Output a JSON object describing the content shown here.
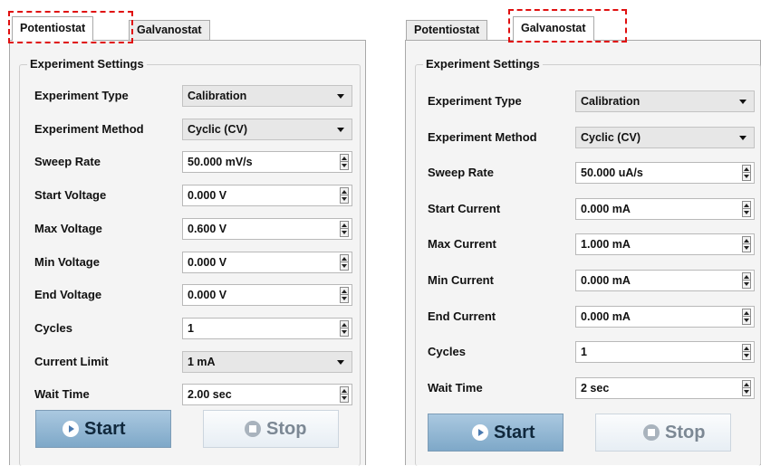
{
  "left_panel": {
    "tabs": [
      {
        "label": "Potentiostat",
        "selected": true
      },
      {
        "label": "Galvanostat",
        "selected": false
      }
    ],
    "group_title": "Experiment Settings",
    "rows": [
      {
        "label": "Experiment Type",
        "value": "Calibration",
        "control": "dropdown"
      },
      {
        "label": "Experiment Method",
        "value": "Cyclic (CV)",
        "control": "dropdown"
      },
      {
        "label": "Sweep Rate",
        "value": "50.000 mV/s",
        "control": "spinner"
      },
      {
        "label": "Start Voltage",
        "value": "0.000 V",
        "control": "spinner"
      },
      {
        "label": "Max Voltage",
        "value": "0.600 V",
        "control": "spinner"
      },
      {
        "label": "Min Voltage",
        "value": "0.000 V",
        "control": "spinner"
      },
      {
        "label": "End Voltage",
        "value": "0.000 V",
        "control": "spinner"
      },
      {
        "label": "Cycles",
        "value": "1",
        "control": "spinner"
      },
      {
        "label": "Current Limit",
        "value": "1 mA",
        "control": "dropdown"
      },
      {
        "label": "Wait Time",
        "value": "2.00 sec",
        "control": "spinner"
      }
    ],
    "start_label": "Start",
    "stop_label": "Stop"
  },
  "right_panel": {
    "tabs": [
      {
        "label": "Potentiostat",
        "selected": false
      },
      {
        "label": "Galvanostat",
        "selected": true
      }
    ],
    "group_title": "Experiment Settings",
    "rows": [
      {
        "label": "Experiment Type",
        "value": "Calibration",
        "control": "dropdown"
      },
      {
        "label": "Experiment Method",
        "value": "Cyclic (CV)",
        "control": "dropdown"
      },
      {
        "label": "Sweep Rate",
        "value": "50.000 uA/s",
        "control": "spinner"
      },
      {
        "label": "Start Current",
        "value": "0.000 mA",
        "control": "spinner"
      },
      {
        "label": "Max Current",
        "value": "1.000 mA",
        "control": "spinner"
      },
      {
        "label": "Min Current",
        "value": "0.000 mA",
        "control": "spinner"
      },
      {
        "label": "End Current",
        "value": "0.000 mA",
        "control": "spinner"
      },
      {
        "label": "Cycles",
        "value": "1",
        "control": "spinner"
      },
      {
        "label": "Wait Time",
        "value": "2 sec",
        "control": "spinner"
      }
    ],
    "start_label": "Start",
    "stop_label": "Stop"
  },
  "colors": {
    "highlight_dashed": "#e01010",
    "start_button": "#8fb4d2",
    "stop_button_text": "#7c8894"
  }
}
